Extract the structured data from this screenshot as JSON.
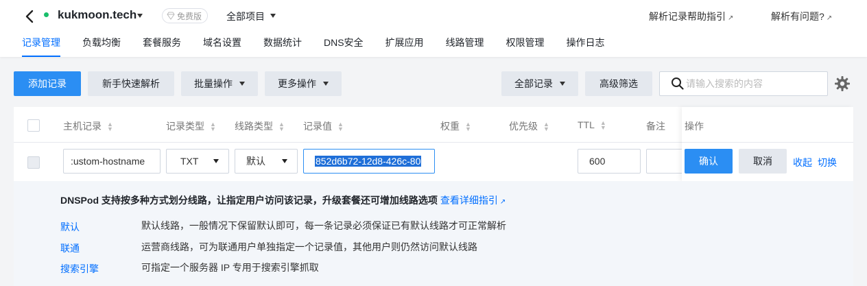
{
  "header": {
    "domain": "kukmoon.tech",
    "plan_badge": "免费版",
    "project": "全部项目",
    "help_link": "解析记录帮助指引",
    "problem_link": "解析有问题?",
    "status_color": "#19be6b"
  },
  "tabs": [
    "记录管理",
    "负载均衡",
    "套餐服务",
    "域名设置",
    "数据统计",
    "DNS安全",
    "扩展应用",
    "线路管理",
    "权限管理",
    "操作日志"
  ],
  "toolbar": {
    "add_record": "添加记录",
    "quick_setup": "新手快速解析",
    "batch_ops": "批量操作",
    "more_ops": "更多操作",
    "all_records": "全部记录",
    "advanced_filter": "高级筛选",
    "search_placeholder": "请输入搜索的内容"
  },
  "table": {
    "columns": {
      "host": "主机记录",
      "type": "记录类型",
      "line": "线路类型",
      "value": "记录值",
      "weight": "权重",
      "priority": "优先级",
      "ttl": "TTL",
      "note": "备注",
      "ops": "操作"
    },
    "edit_row": {
      "host": ":ustom-hostname",
      "type": "TXT",
      "line": "默认",
      "value": "852d6b72-12d8-426c-80",
      "ttl": "600",
      "note": "",
      "confirm": "确认",
      "cancel": "取消",
      "collapse": "收起",
      "switch": "切换"
    }
  },
  "tip": {
    "title": "DNSPod 支持按多种方式划分线路，让指定用户访问该记录，升级套餐还可增加线路选项",
    "link": "查看详细指引",
    "rows": [
      {
        "key": "默认",
        "desc": "默认线路，一般情况下保留默认即可，每一条记录必须保证已有默认线路才可正常解析"
      },
      {
        "key": "联通",
        "desc": "运营商线路，可为联通用户单独指定一个记录值，其他用户则仍然访问默认线路"
      },
      {
        "key": "搜索引擎",
        "desc": "可指定一个服务器 IP 专用于搜索引擎抓取"
      }
    ]
  },
  "colors": {
    "accent": "#006eff",
    "primary_button": "#2b8ef3"
  }
}
